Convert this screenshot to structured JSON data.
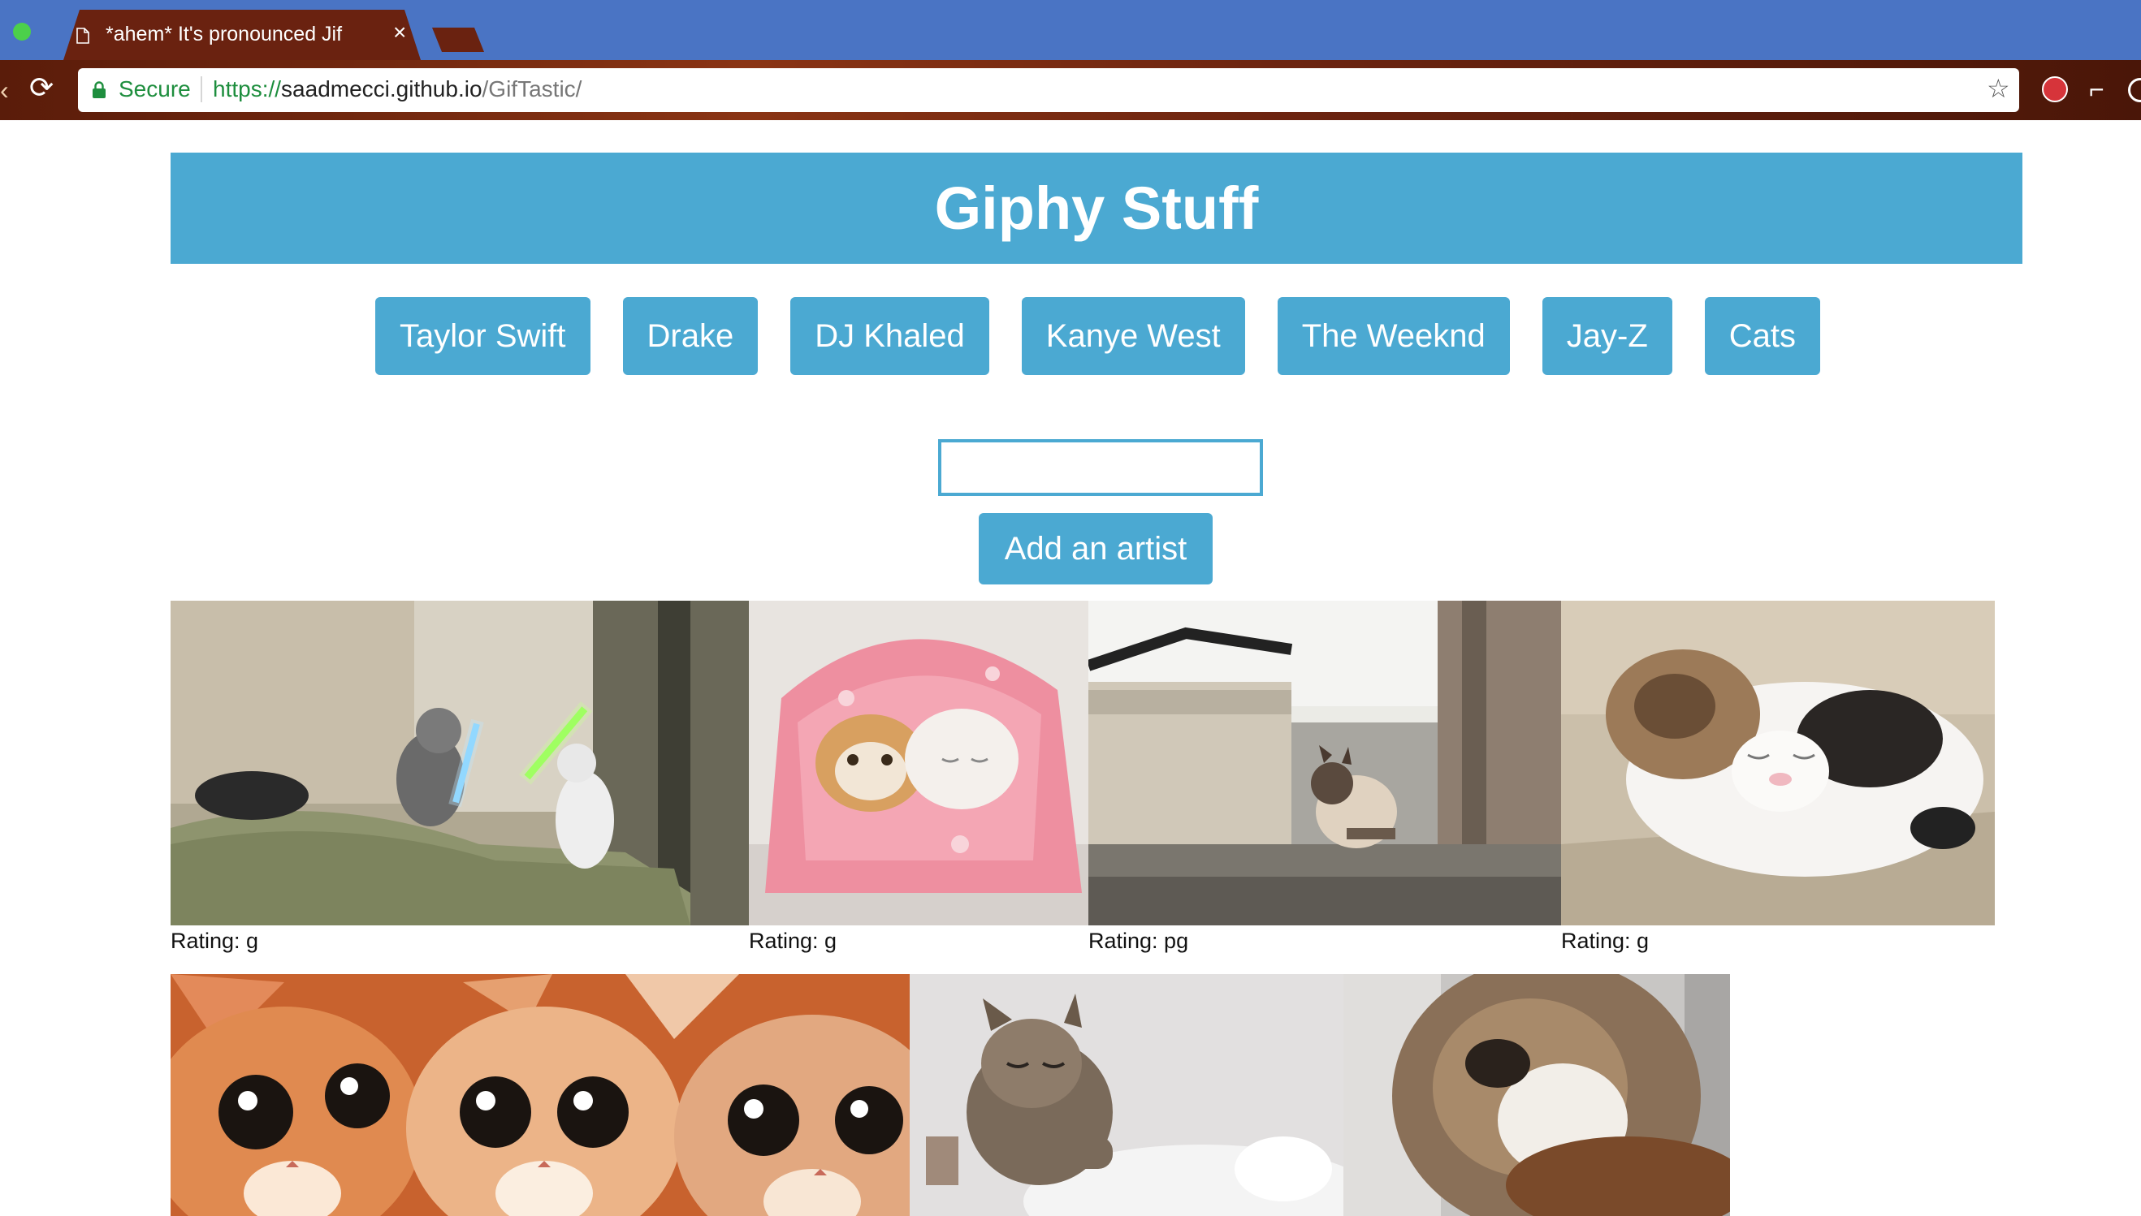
{
  "browser": {
    "tab_title": "*ahem* It's pronounced Jif",
    "tab_close": "×",
    "security_label": "Secure",
    "url_scheme": "https://",
    "url_host": "saadmecci.github.io",
    "url_path": "/GifTastic/"
  },
  "page": {
    "title": "Giphy Stuff",
    "accent_color": "#4ba9d2",
    "artist_buttons": [
      "Taylor Swift",
      "Drake",
      "DJ Khaled",
      "Kanye West",
      "The Weeknd",
      "Jay-Z",
      "Cats"
    ],
    "artist_input_value": "",
    "add_button_label": "Add an artist",
    "gifs": [
      {
        "subject": "two cats fighting with lightsabers on a couch",
        "rating": "Rating: g"
      },
      {
        "subject": "two kittens wrapped in a pink blanket",
        "rating": "Rating: g"
      },
      {
        "subject": "siamese cat on a windowsill",
        "rating": "Rating: pg"
      },
      {
        "subject": "calico cat sleeping on floor",
        "rating": "Rating: g"
      },
      {
        "subject": "three big-eyed cartoon cats",
        "rating": ""
      },
      {
        "subject": "tabby kitten pawing a white cat",
        "rating": ""
      },
      {
        "subject": "kitten close-up playing",
        "rating": ""
      }
    ]
  }
}
